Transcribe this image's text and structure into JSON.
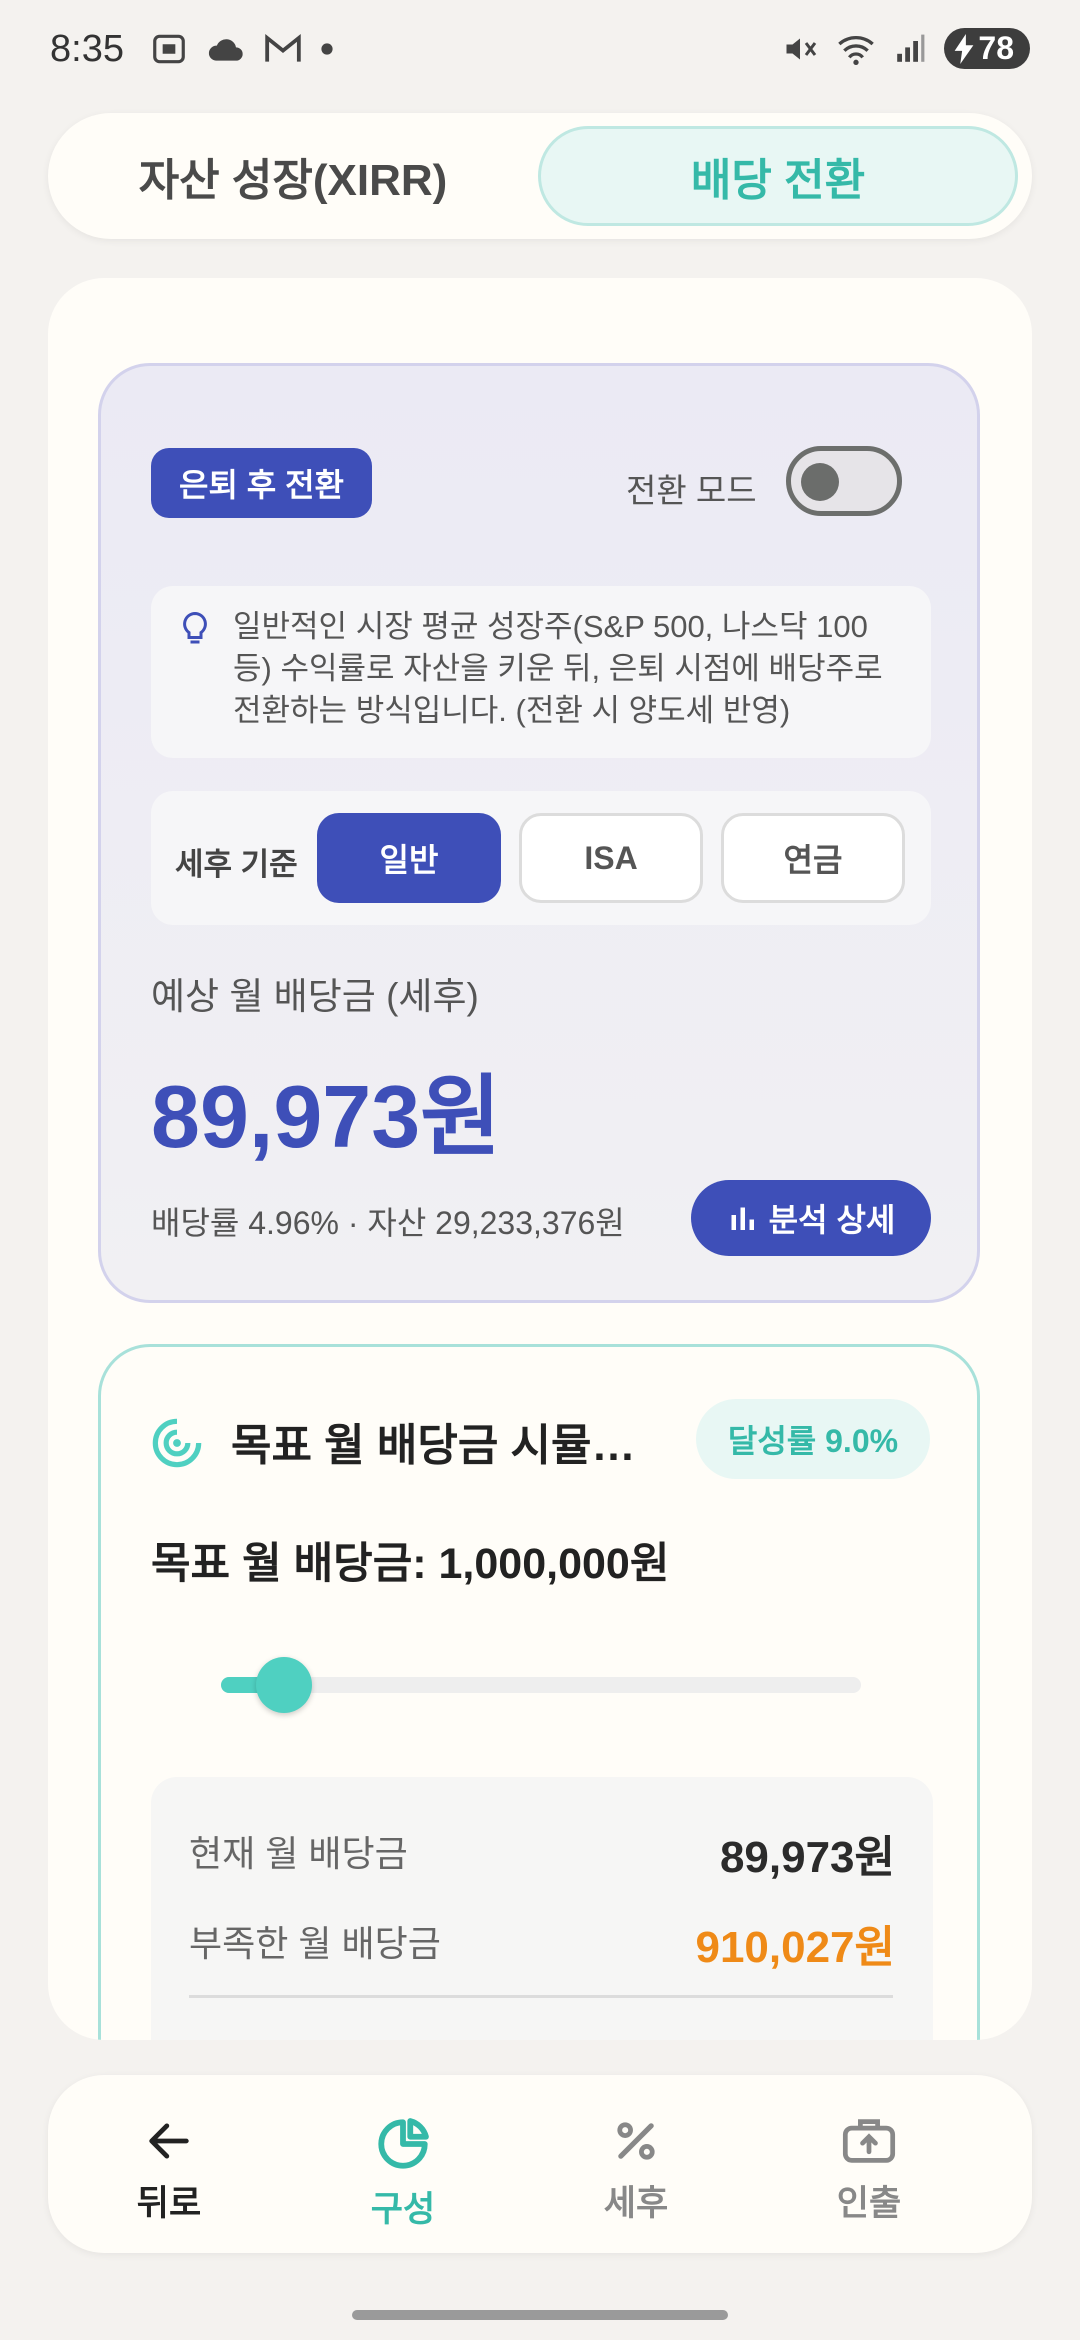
{
  "status_bar": {
    "time": "8:35",
    "battery": "78"
  },
  "tabs": {
    "left": "자산 성장(XIRR)",
    "right": "배당 전환"
  },
  "conversion_card": {
    "badge": "은퇴 후 전환",
    "mode_label": "전환 모드",
    "mode_on": false,
    "tip": "일반적인 시장 평균 성장주(S&P 500, 나스닥 100 등) 수익률로 자산을 키운 뒤, 은퇴 시점에 배당주로 전환하는 방식입니다. (전환 시 양도세 반영)",
    "tax_label": "세후 기준",
    "tax_options": [
      "일반",
      "ISA",
      "연금"
    ],
    "tax_selected": "일반",
    "expected_label": "예상 월 배당금 (세후)",
    "expected_value": "89,973원",
    "meta": "배당률 4.96%  ·  자산 29,233,376원",
    "analysis_button": "분석 상세"
  },
  "goal_card": {
    "title": "목표 월 배당금 시뮬레이션",
    "achievement": "달성률 9.0%",
    "target": "목표 월 배당금: 1,000,000원",
    "slider_fraction": 0.1,
    "rows": [
      {
        "label": "현재 월 배당금",
        "value": "89,973원",
        "color": "#2b2b2b"
      },
      {
        "label": "부족한 월 배당금",
        "value": "910,027원",
        "color": "#ef8a17"
      }
    ]
  },
  "bottom_nav": [
    {
      "label": "뒤로",
      "icon": "arrow-left-icon",
      "active": false
    },
    {
      "label": "구성",
      "icon": "pie-chart-icon",
      "active": true
    },
    {
      "label": "세후",
      "icon": "percent-icon",
      "active": false
    },
    {
      "label": "인출",
      "icon": "briefcase-upload-icon",
      "active": false
    }
  ],
  "colors": {
    "primary": "#3e4fb8",
    "accent": "#35b9a8",
    "warning": "#ef8a17"
  }
}
